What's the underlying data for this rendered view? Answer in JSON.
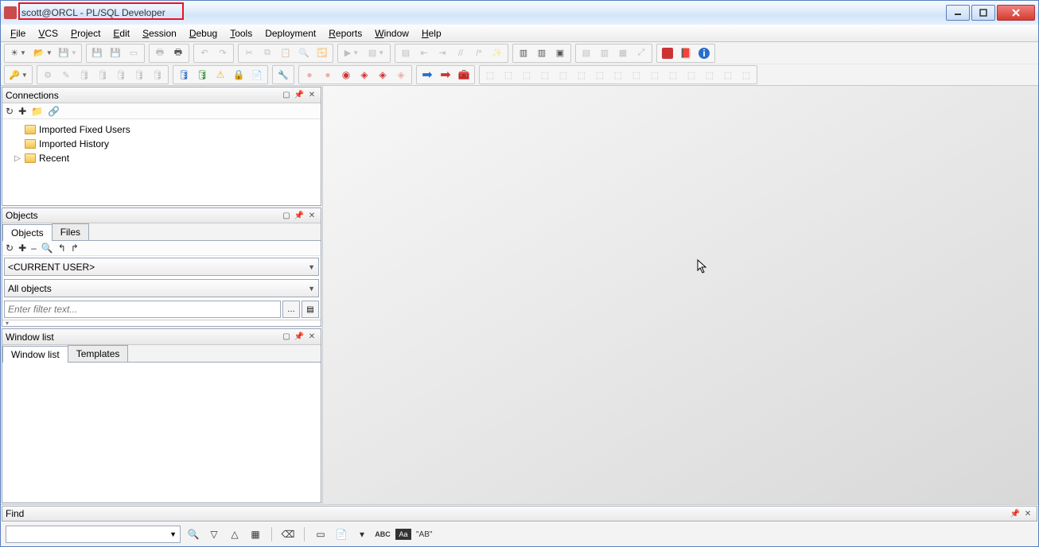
{
  "title": "scott@ORCL - PL/SQL Developer",
  "menus": [
    "File",
    "VCS",
    "Project",
    "Edit",
    "Session",
    "Debug",
    "Tools",
    "Deployment",
    "Reports",
    "Window",
    "Help"
  ],
  "connections": {
    "title": "Connections",
    "items": [
      {
        "label": "Imported Fixed Users",
        "expandable": false
      },
      {
        "label": "Imported History",
        "expandable": false
      },
      {
        "label": "Recent",
        "expandable": true
      }
    ]
  },
  "objects": {
    "title": "Objects",
    "tabs": [
      "Objects",
      "Files"
    ],
    "userCombo": "<CURRENT USER>",
    "scopeCombo": "All objects",
    "filterPlaceholder": "Enter filter text..."
  },
  "windowlist": {
    "title": "Window list",
    "tabs": [
      "Window list",
      "Templates"
    ]
  },
  "find": {
    "title": "Find"
  },
  "findrow": {
    "label_abc": "ABC",
    "label_rep": "\"AB\""
  }
}
